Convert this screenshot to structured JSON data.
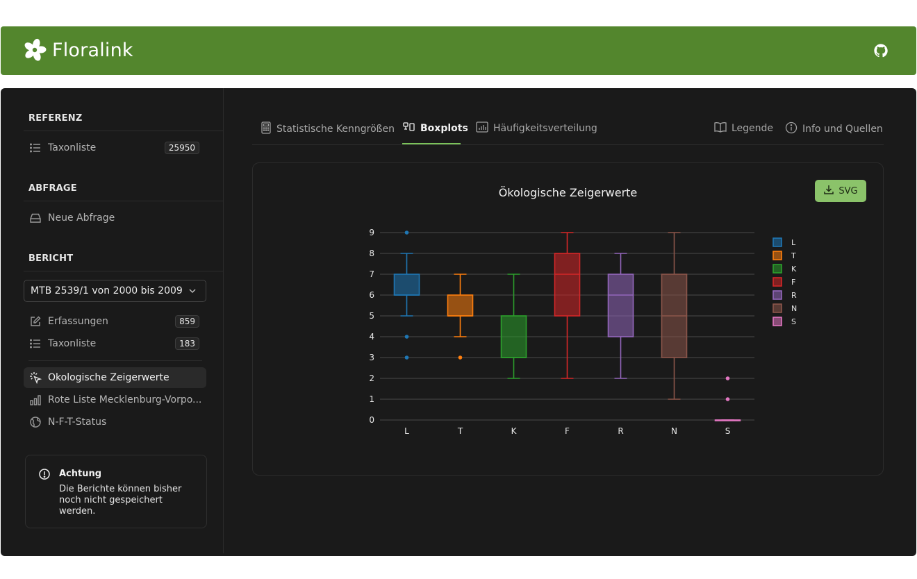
{
  "app": {
    "name": "Floralink"
  },
  "sidebar": {
    "referenz": {
      "title": "REFERENZ",
      "items": [
        {
          "label": "Taxonliste",
          "count": "25950"
        }
      ]
    },
    "abfrage": {
      "title": "ABFRAGE",
      "items": [
        {
          "label": "Neue Abfrage"
        }
      ]
    },
    "bericht": {
      "title": "BERICHT",
      "select_value": "MTB 2539/1 von 2000 bis 2009",
      "items": [
        {
          "label": "Erfassungen",
          "count": "859"
        },
        {
          "label": "Taxonliste",
          "count": "183"
        }
      ],
      "reports": [
        {
          "label": "Ökologische Zeigerwerte",
          "active": true
        },
        {
          "label": "Rote Liste Mecklenburg-Vorpo..."
        },
        {
          "label": "N-F-T-Status"
        }
      ]
    },
    "alert": {
      "title": "Achtung",
      "body": "Die Berichte können bisher noch nicht gespeichert werden."
    }
  },
  "tabs": [
    {
      "label": "Statistische Kenngrößen",
      "icon": "calculator-icon"
    },
    {
      "label": "Boxplots",
      "icon": "boxplot-icon",
      "active": true
    },
    {
      "label": "Häufigkeitsverteilung",
      "icon": "bar-chart-icon"
    },
    {
      "label": "Legende",
      "icon": "book-icon"
    },
    {
      "label": "Info und Quellen",
      "icon": "info-icon"
    }
  ],
  "export_button": "SVG",
  "colors": {
    "header": "#53862d",
    "accent": "#7bc25a",
    "button": "#8bc36a"
  },
  "chart_data": {
    "type": "boxplot",
    "title": "Ökologische Zeigerwerte",
    "xlabel": "",
    "ylabel": "",
    "ylim": [
      0,
      9
    ],
    "yticks": [
      "0",
      "1",
      "2",
      "3",
      "4",
      "5",
      "6",
      "7",
      "8",
      "9"
    ],
    "grid": true,
    "legend_position": "right",
    "categories": [
      "L",
      "T",
      "K",
      "F",
      "R",
      "N",
      "S"
    ],
    "series": [
      {
        "name": "L",
        "color": "#1f77b4",
        "min": 5,
        "q1": 6,
        "median": 6,
        "q3": 7,
        "max": 8,
        "outliers": [
          9,
          4,
          3
        ]
      },
      {
        "name": "T",
        "color": "#ff7f0e",
        "min": 4,
        "q1": 5,
        "median": 5,
        "q3": 6,
        "max": 7,
        "outliers": [
          3
        ]
      },
      {
        "name": "K",
        "color": "#2ca02c",
        "min": 2,
        "q1": 3,
        "median": 3,
        "q3": 5,
        "max": 7,
        "outliers": []
      },
      {
        "name": "F",
        "color": "#d62728",
        "min": 2,
        "q1": 5,
        "median": 7,
        "q3": 8,
        "max": 9,
        "outliers": []
      },
      {
        "name": "R",
        "color": "#9467bd",
        "min": 2,
        "q1": 4,
        "median": 6,
        "q3": 7,
        "max": 8,
        "outliers": []
      },
      {
        "name": "N",
        "color": "#8c564b",
        "min": 1,
        "q1": 3,
        "median": 5,
        "q3": 7,
        "max": 9,
        "outliers": []
      },
      {
        "name": "S",
        "color": "#e377c2",
        "min": 0,
        "q1": 0,
        "median": 0,
        "q3": 0,
        "max": 0,
        "outliers": [
          2,
          1
        ]
      }
    ]
  }
}
